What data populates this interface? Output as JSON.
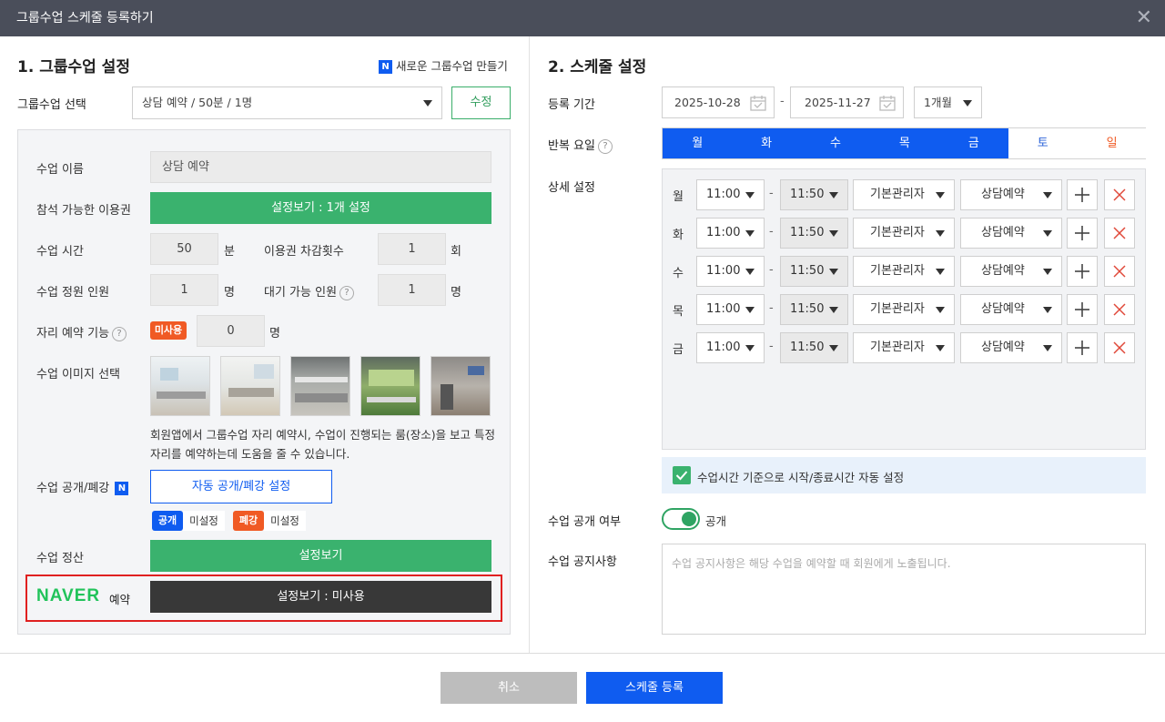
{
  "window": {
    "title": "그룹수업 스케줄 등록하기"
  },
  "left": {
    "section_title": "1. 그룹수업 설정",
    "new_group_link": "새로운 그룹수업 만들기",
    "new_badge": "N",
    "group_select_label": "그룹수업 선택",
    "group_select_value": "상담 예약 / 50분 / 1명",
    "edit_button": "수정",
    "class_name_label": "수업 이름",
    "class_name_value": "상담 예약",
    "ticket_label": "참석 가능한 이용권",
    "ticket_button": "설정보기 : 1개 설정",
    "duration_label": "수업 시간",
    "duration_value": "50",
    "duration_unit": "분",
    "deduct_label": "이용권 차감횟수",
    "deduct_value": "1",
    "deduct_unit": "회",
    "capacity_label": "수업 정원 인원",
    "capacity_value": "1",
    "capacity_unit": "명",
    "waitlist_label": "대기 가능 인원",
    "waitlist_value": "1",
    "waitlist_unit": "명",
    "seat_label": "자리 예약 기능",
    "seat_badge": "미사용",
    "seat_value": "0",
    "seat_unit": "명",
    "image_label": "수업 이미지 선택",
    "image_desc": "회원앱에서 그룹수업 자리 예약시, 수업이 진행되는 룸(장소)을 보고 특정 자리를 예약하는데 도움을 줄 수 있습니다.",
    "open_close_label": "수업 공개/폐강",
    "open_close_button": "자동 공개/폐강 설정",
    "open_badge": "공개",
    "open_status": "미설정",
    "close_badge": "폐강",
    "close_status": "미설정",
    "settle_label": "수업 정산",
    "settle_button": "설정보기",
    "naver_logo": "NAVER",
    "naver_label": "예약",
    "naver_button": "설정보기 : 미사용",
    "help_glyph": "?"
  },
  "right": {
    "section_title": "2. 스케줄 설정",
    "period_label": "등록 기간",
    "start_date": "2025-10-28",
    "date_sep": "-",
    "end_date": "2025-11-27",
    "period_select": "1개월",
    "repeat_label": "반복 요일",
    "days": [
      {
        "label": "월",
        "selected": true
      },
      {
        "label": "화",
        "selected": true
      },
      {
        "label": "수",
        "selected": true
      },
      {
        "label": "목",
        "selected": true
      },
      {
        "label": "금",
        "selected": true
      },
      {
        "label": "토",
        "selected": false
      },
      {
        "label": "일",
        "selected": false
      }
    ],
    "detail_label": "상세 설정",
    "schedule_rows": [
      {
        "day": "월",
        "start": "11:00",
        "end": "11:50",
        "manager": "기본관리자",
        "type": "상담예약"
      },
      {
        "day": "화",
        "start": "11:00",
        "end": "11:50",
        "manager": "기본관리자",
        "type": "상담예약"
      },
      {
        "day": "수",
        "start": "11:00",
        "end": "11:50",
        "manager": "기본관리자",
        "type": "상담예약"
      },
      {
        "day": "목",
        "start": "11:00",
        "end": "11:50",
        "manager": "기본관리자",
        "type": "상담예약"
      },
      {
        "day": "금",
        "start": "11:00",
        "end": "11:50",
        "manager": "기본관리자",
        "type": "상담예약"
      }
    ],
    "auto_time_label": "수업시간 기준으로 시작/종료시간 자동 설정",
    "public_label": "수업 공개 여부",
    "public_value": "공개",
    "notice_label": "수업 공지사항",
    "notice_placeholder": "수업 공지사항은 해당 수업을 예약할 때 회원에게 노출됩니다.",
    "time_sep": "-"
  },
  "footer": {
    "cancel": "취소",
    "submit": "스케줄 등록"
  },
  "colors": {
    "accent_blue": "#0f5cf0",
    "green": "#3ab26e",
    "orange": "#f05a24",
    "highlight_red": "#e02020"
  }
}
